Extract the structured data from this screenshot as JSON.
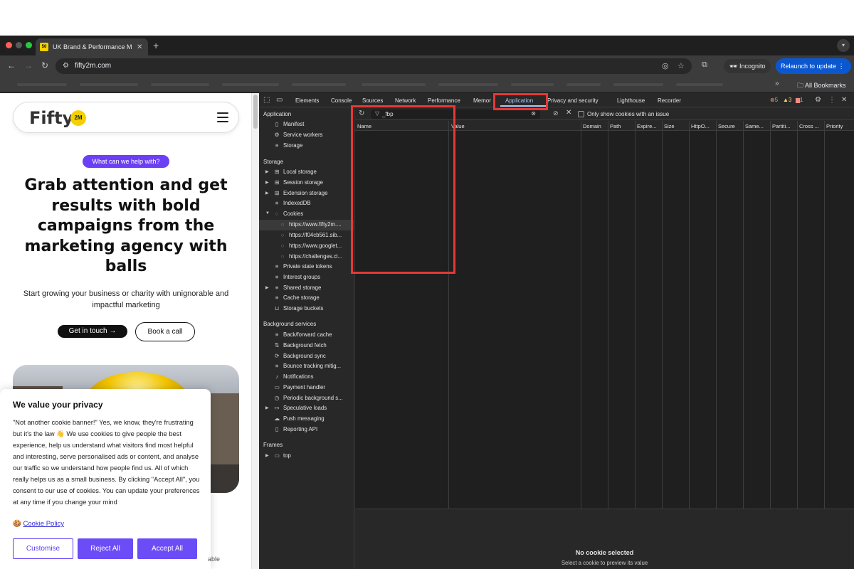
{
  "browser": {
    "tab_title": "UK Brand & Performance Mar",
    "tab_favicon_text": "50",
    "url": "fifty2m.com",
    "incognito_label": "Incognito",
    "relaunch_label": "Relaunch to update",
    "all_bookmarks_label": "All Bookmarks"
  },
  "page": {
    "logo_text": "Fifty",
    "logo_badge": "2M",
    "pill": "What can we help with?",
    "hero": "Grab attention and get results with bold campaigns from the marketing agency with balls",
    "subtitle": "Start growing your business or charity with unignorable and impactful marketing",
    "cta_primary": "Get in touch →",
    "cta_secondary": "Book a call",
    "partial_text": "able"
  },
  "cookie_banner": {
    "title": "We value your privacy",
    "body": "\"Not another cookie banner!\" Yes, we know, they're frustrating but it's the law 👋 We use cookies to give people the best experience, help us understand what visitors find most helpful and interesting, serve personalised ads or content, and analyse our traffic so we understand how people find us. All of which really helps us as a small business. By clicking \"Accept All\", you consent to our use of cookies. You can update your preferences at any time if you change your mind",
    "policy_emoji": "🍪",
    "policy_link": "Cookie Policy",
    "customise": "Customise",
    "reject": "Reject All",
    "accept": "Accept All"
  },
  "devtools": {
    "tabs": [
      "Elements",
      "Console",
      "Sources",
      "Network",
      "Performance",
      "Memor",
      "Application",
      "Privacy and security",
      "Lighthouse",
      "Recorder"
    ],
    "active_tab": "Application",
    "errors": "5",
    "warnings": "3",
    "issues": "1",
    "sections": {
      "application": "Application",
      "storage": "Storage",
      "background": "Background services",
      "frames": "Frames"
    },
    "application_items": [
      "Manifest",
      "Service workers",
      "Storage"
    ],
    "storage_items": [
      "Local storage",
      "Session storage",
      "Extension storage",
      "IndexedDB",
      "Cookies"
    ],
    "cookie_origins": [
      "https://www.fifty2m....",
      "https://f04cb561.sib...",
      "https://www.googlet...",
      "https://challenges.cl..."
    ],
    "storage_items_2": [
      "Private state tokens",
      "Interest groups",
      "Shared storage",
      "Cache storage",
      "Storage buckets"
    ],
    "background_items": [
      "Back/forward cache",
      "Background fetch",
      "Background sync",
      "Bounce tracking mitig...",
      "Notifications",
      "Payment handler",
      "Periodic background s...",
      "Speculative loads",
      "Push messaging",
      "Reporting API"
    ],
    "frames_items": [
      "top"
    ],
    "filter_value": "_fbp",
    "only_issues_label": "Only show cookies with an issue",
    "columns": [
      "Name",
      "Value",
      "Domain",
      "Path",
      "Expire...",
      "Size",
      "HttpO...",
      "Secure",
      "Same...",
      "Partiti...",
      "Cross ...",
      "Priority"
    ],
    "no_selection_title": "No cookie selected",
    "no_selection_sub": "Select a cookie to preview its value"
  },
  "colors": {
    "accent_purple": "#6b40f4",
    "highlight_red": "#e53935",
    "devtools_active": "#a8c7fa",
    "relaunch_blue": "#0b57d0"
  }
}
